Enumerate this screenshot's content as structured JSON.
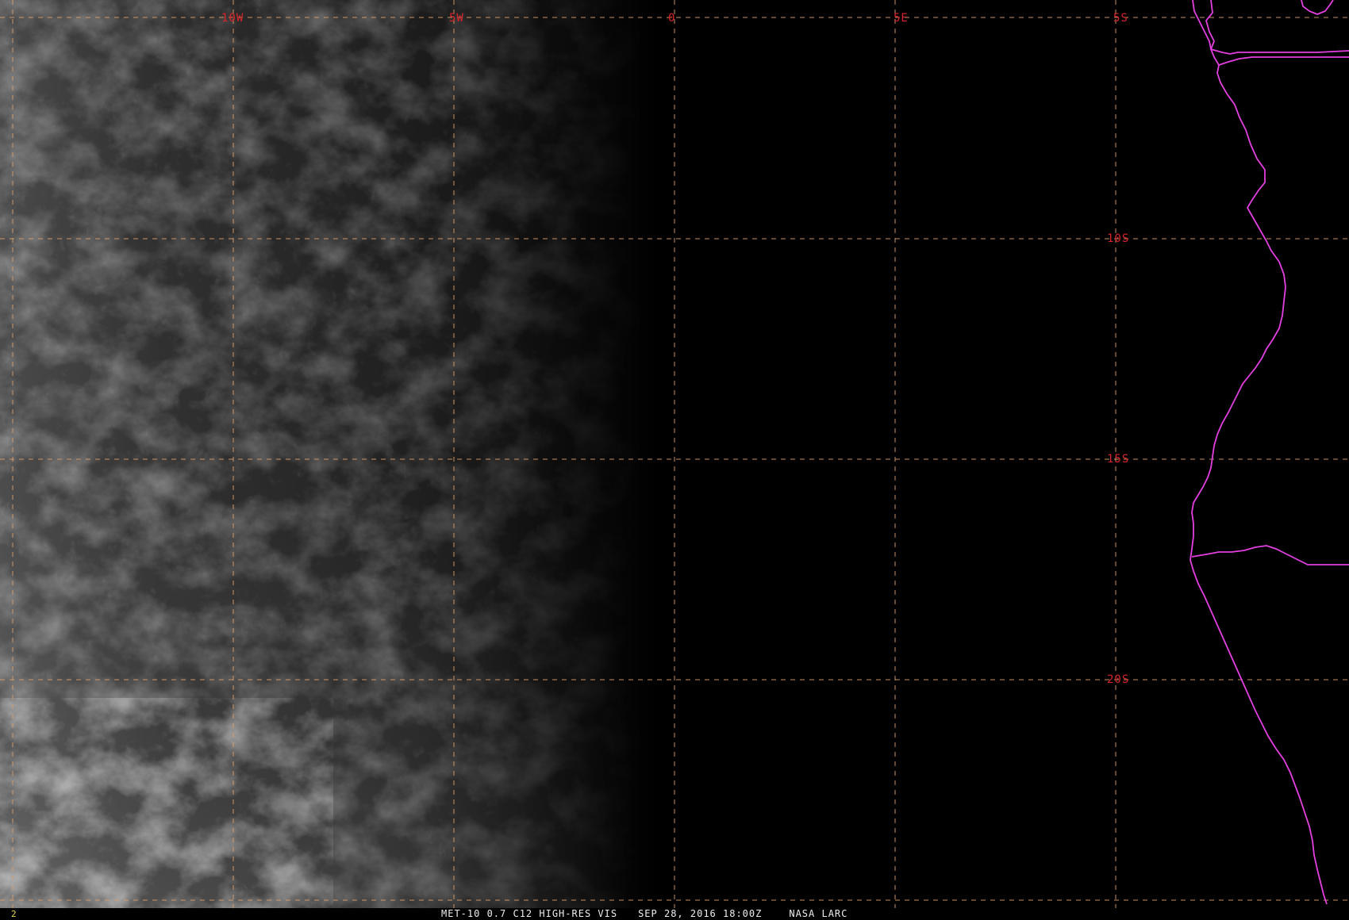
{
  "image": {
    "satellite_channel": "MET-10 0.7 C12 HIGH-RES VIS",
    "date_time": "SEP 28, 2016 18:00Z",
    "source": "NASA LARC",
    "frame_number": "2"
  },
  "grid": {
    "longitude_labels": [
      "10W",
      "5W",
      "0",
      "5E"
    ],
    "latitude_labels": [
      "5S",
      "10S",
      "15S",
      "20S"
    ]
  },
  "colors": {
    "background": "#000000",
    "grid_line": "#d9a06a",
    "grid_label": "#d8232a",
    "political_border": "#e43fe0",
    "caption_text": "#eeeeee",
    "frame_number": "#e6d84a"
  },
  "map_features": {
    "coastline_icon": "coastline-outline",
    "cloud_field_icon": "cloud-field"
  }
}
